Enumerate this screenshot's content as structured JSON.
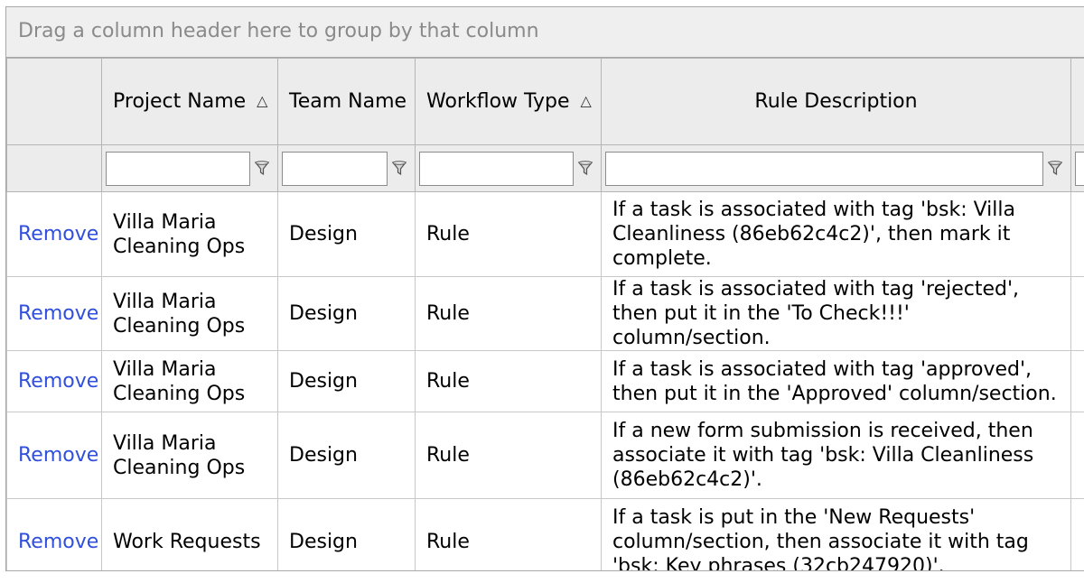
{
  "group_panel": {
    "text": "Drag a column header here to group by that column"
  },
  "columns": [
    {
      "label": ""
    },
    {
      "label": "Project Name",
      "sorted": true
    },
    {
      "label": "Team Name"
    },
    {
      "label": "Workflow Type",
      "sorted": true
    },
    {
      "label": "Rule Description"
    },
    {
      "label": ""
    }
  ],
  "filters": {
    "project_name": "",
    "team_name": "",
    "workflow_type": "",
    "rule_description": ""
  },
  "rows": [
    {
      "action": "Remove",
      "project_name": "Villa Maria Cleaning Ops",
      "team_name": "Design",
      "workflow_type": "Rule",
      "rule_description": "If a task is associated with tag 'bsk: Villa Cleanliness (86eb62c4c2)', then mark it complete."
    },
    {
      "action": "Remove",
      "project_name": "Villa Maria Cleaning Ops",
      "team_name": "Design",
      "workflow_type": "Rule",
      "rule_description": "If a task is associated with tag 'rejected', then put it in the 'To Check!!!' column/section."
    },
    {
      "action": "Remove",
      "project_name": "Villa Maria Cleaning Ops",
      "team_name": "Design",
      "workflow_type": "Rule",
      "rule_description": "If a task is associated with tag 'approved', then put it in the 'Approved' column/section."
    },
    {
      "action": "Remove",
      "project_name": "Villa Maria Cleaning Ops",
      "team_name": "Design",
      "workflow_type": "Rule",
      "rule_description": "If a new form submission is received, then associate it with tag 'bsk: Villa Cleanliness (86eb62c4c2)'."
    },
    {
      "action": "Remove",
      "project_name": "Work Requests",
      "team_name": "Design",
      "workflow_type": "Rule",
      "rule_description": "If a task is put in the 'New Requests' column/section, then associate it with tag 'bsk: Key phrases (32cb247920)'."
    }
  ]
}
